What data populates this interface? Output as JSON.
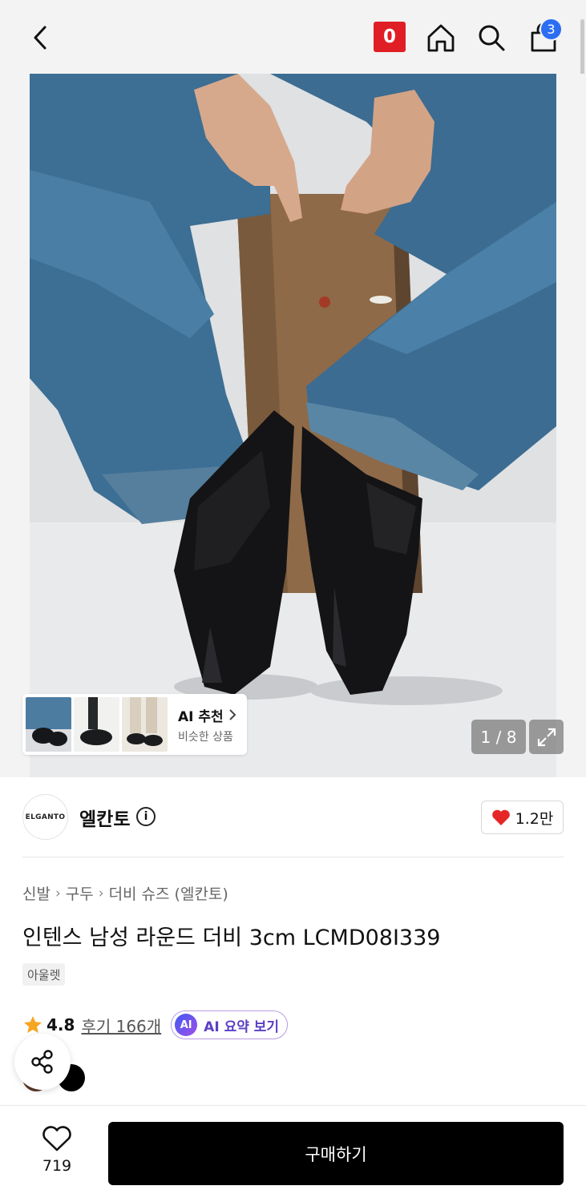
{
  "header": {
    "zero_badge": "0",
    "cart_count": "3",
    "icons": [
      "back-icon",
      "home-icon",
      "search-icon",
      "shopping-bag-icon"
    ]
  },
  "gallery": {
    "counter": "1 / 8",
    "ai_recommend": {
      "title": "AI 추천",
      "subtitle": "비슷한 상품"
    }
  },
  "brand": {
    "logo_text": "ELGANTO",
    "name": "엘칸토",
    "likes": "1.2만"
  },
  "product": {
    "breadcrumb": [
      "신발",
      "구두",
      "더비 슈즈 (엘칸토)"
    ],
    "title": "인텐스 남성 라운드 더비 3cm LCMD08I339",
    "tag": "아울렛",
    "rating": "4.8",
    "reviews": "후기 166개",
    "ai_summary_badge": "AI",
    "ai_summary": "AI 요약 보기",
    "color_swatches": [
      "#5a3a26",
      "#000000"
    ]
  },
  "bottom": {
    "wish_count": "719",
    "buy_label": "구매하기"
  },
  "colors": {
    "accent_red": "#e01e25",
    "badge_blue": "#2c6ef2",
    "heart_red": "#e52626",
    "star": "#f6a623"
  }
}
